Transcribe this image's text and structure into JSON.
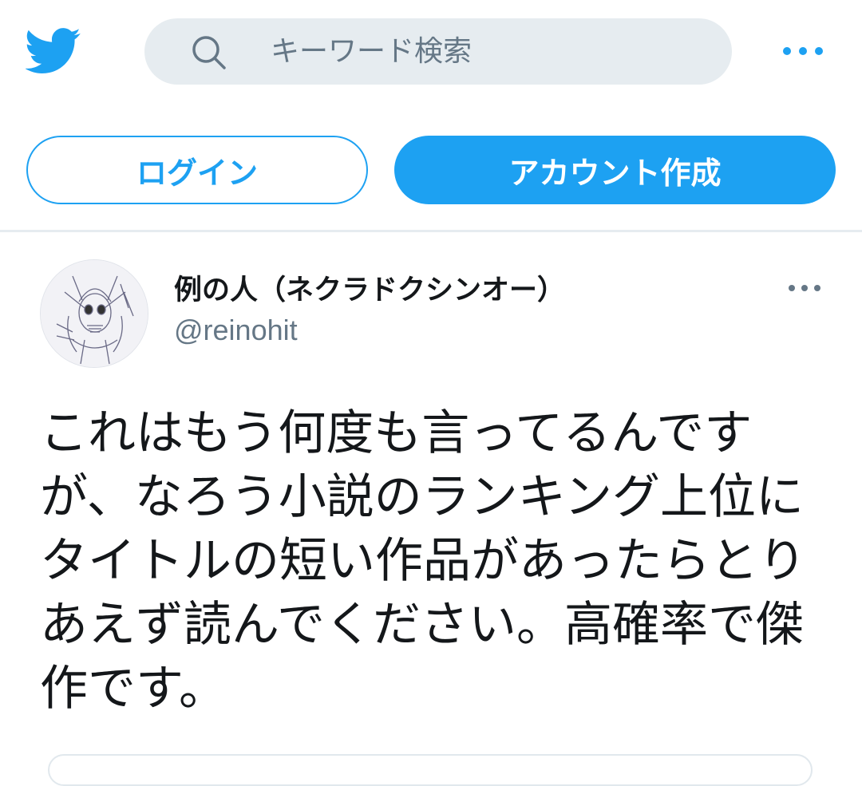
{
  "header": {
    "logo_icon": "twitter-bird-icon",
    "search": {
      "placeholder": "キーワード検索",
      "value": ""
    },
    "more_icon": "more-dots-icon"
  },
  "auth": {
    "login_label": "ログイン",
    "signup_label": "アカウント作成"
  },
  "tweet": {
    "author": {
      "display_name": "例の人（ネクラドクシンオー）",
      "handle": "@reinohit"
    },
    "text": "これはもう何度も言ってるんですが、なろう小説のランキング上位にタイトルの短い作品があったらとりあえず読んでください。高確率で傑作です。"
  },
  "colors": {
    "brand": "#1da1f2",
    "search_bg": "#e6ecf0",
    "secondary_text": "#657786",
    "primary_text": "#14171a"
  }
}
